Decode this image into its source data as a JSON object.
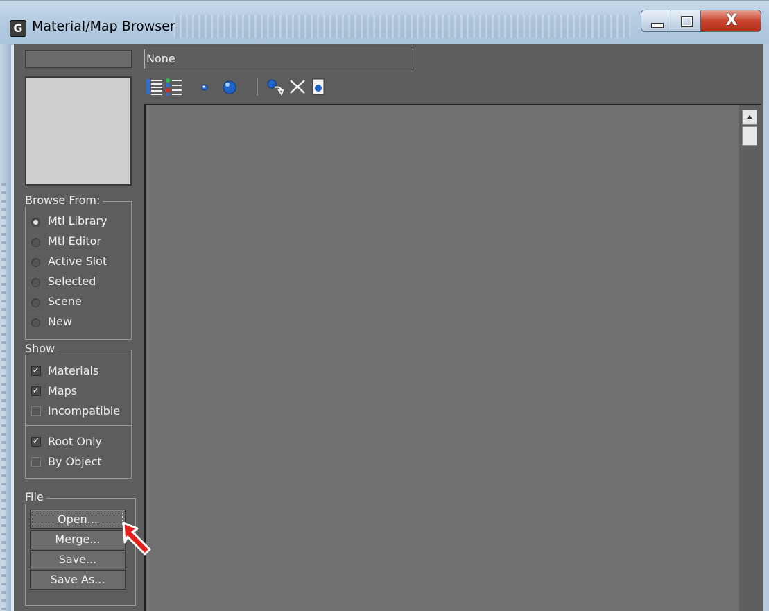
{
  "window": {
    "title": "Material/Map Browser",
    "close_glyph": "X"
  },
  "search": {
    "value": "None"
  },
  "browse_from": {
    "label": "Browse From:",
    "options": [
      {
        "label": "Mtl Library",
        "checked": true
      },
      {
        "label": "Mtl Editor",
        "checked": false
      },
      {
        "label": "Active Slot",
        "checked": false
      },
      {
        "label": "Selected",
        "checked": false
      },
      {
        "label": "Scene",
        "checked": false
      },
      {
        "label": "New",
        "checked": false
      }
    ]
  },
  "show": {
    "label": "Show",
    "options": [
      {
        "label": "Materials",
        "checked": true
      },
      {
        "label": "Maps",
        "checked": true
      },
      {
        "label": "Incompatible",
        "checked": false
      }
    ],
    "options2": [
      {
        "label": "Root Only",
        "checked": true
      },
      {
        "label": "By Object",
        "checked": false
      }
    ]
  },
  "file": {
    "label": "File",
    "buttons": [
      "Open...",
      "Merge...",
      "Save...",
      "Save As..."
    ]
  },
  "toolbar_icons": [
    "view-list-icon",
    "view-list-icons-icon",
    "small-icons-icon",
    "large-icons-icon",
    "update-scene-materials-icon",
    "delete-from-library-icon",
    "clear-library-icon"
  ],
  "colors": {
    "panel": "#5d5d5d",
    "list": "#727272",
    "accent_cursor": "#e0201a"
  }
}
